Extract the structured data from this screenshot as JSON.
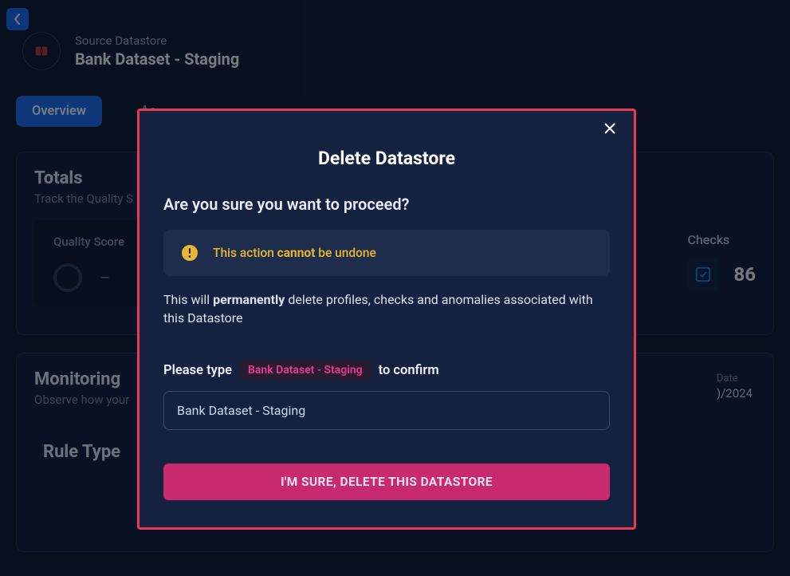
{
  "header": {
    "subtitle": "Source Datastore",
    "title": "Bank Dataset - Staging"
  },
  "tabs": {
    "overview": "Overview",
    "activity_partial": "Ac"
  },
  "totals": {
    "heading": "Totals",
    "sub": "Track the Quality S",
    "quality_label": "Quality Score",
    "quality_value": "–",
    "checks_label": "Checks",
    "checks_value": "86"
  },
  "monitoring": {
    "heading": "Monitoring",
    "sub": "Observe how your",
    "date_label": "Date",
    "date_value": ")/2024",
    "rule_type_heading": "Rule Type"
  },
  "modal": {
    "title": "Delete Datastore",
    "subtitle": "Are you sure you want to proceed?",
    "warn_prefix": "This action ",
    "warn_bold": "cannot",
    "warn_suffix": " be undone",
    "perm_prefix": "This will ",
    "perm_bold": "permanently",
    "perm_suffix": " delete profiles, checks and anomalies associated with this Datastore",
    "confirm_prefix": "Please type",
    "confirm_badge": "Bank Dataset - Staging",
    "confirm_suffix": "to confirm",
    "input_value": "Bank Dataset - Staging",
    "button_label": "I'M SURE, DELETE THIS DATASTORE"
  }
}
